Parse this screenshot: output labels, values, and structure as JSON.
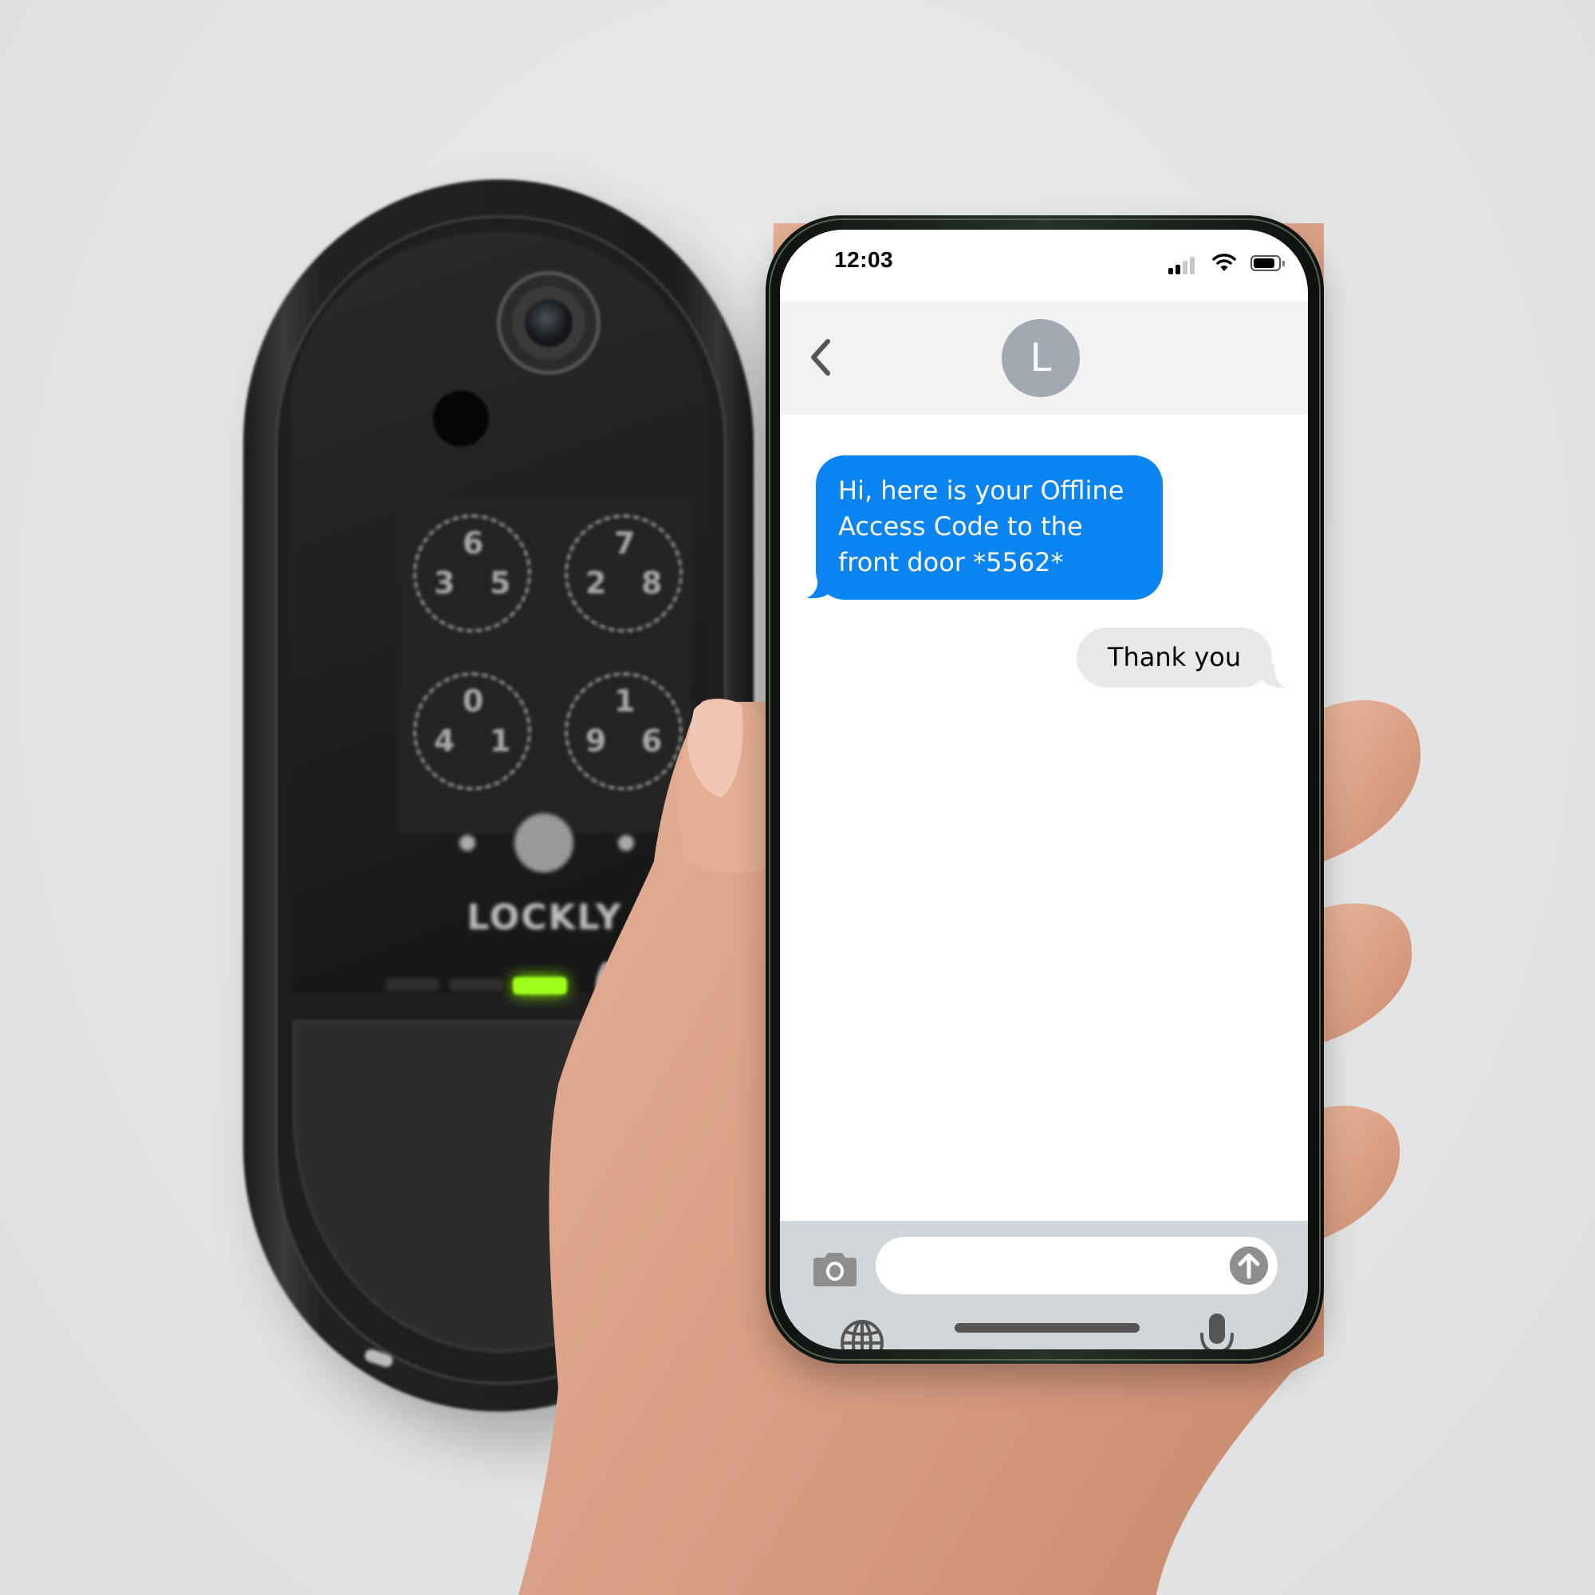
{
  "scene": {
    "background_color": "#e4e6e8"
  },
  "lock_device": {
    "brand": "LOCKLY",
    "keypad": [
      {
        "top": "6",
        "left": "3",
        "right": "5"
      },
      {
        "top": "7",
        "left": "2",
        "right": "8"
      },
      {
        "top": "0",
        "left": "4",
        "right": "1"
      },
      {
        "top": "1",
        "left": "9",
        "right": "6"
      }
    ],
    "status_led_color": "#9eff1a"
  },
  "phone": {
    "status_bar": {
      "time": "12:03",
      "signal_bars_active": 2,
      "signal_bars_total": 4,
      "wifi_icon": "wifi-icon",
      "battery_icon": "battery-icon"
    },
    "header": {
      "back_icon": "chevron-left-icon",
      "contact_initial": "L",
      "avatar_color": "#a3a9b3"
    },
    "messages": [
      {
        "direction": "incoming",
        "text": "Hi, here is your Offline Access Code to the front door *5562*",
        "lines": [
          "Hi, here is your Offline",
          "Access Code to the",
          "front door *5562*"
        ],
        "bubble_color": "#0b84f3"
      },
      {
        "direction": "outgoing",
        "text": "Thank you",
        "bubble_color": "#e9e9eb"
      }
    ],
    "composer": {
      "camera_icon": "camera-icon",
      "input_value": "",
      "input_placeholder": "",
      "send_icon": "arrow-up-circle-icon",
      "globe_icon": "globe-icon",
      "mic_icon": "microphone-icon",
      "background_color": "#d1d6da"
    }
  }
}
